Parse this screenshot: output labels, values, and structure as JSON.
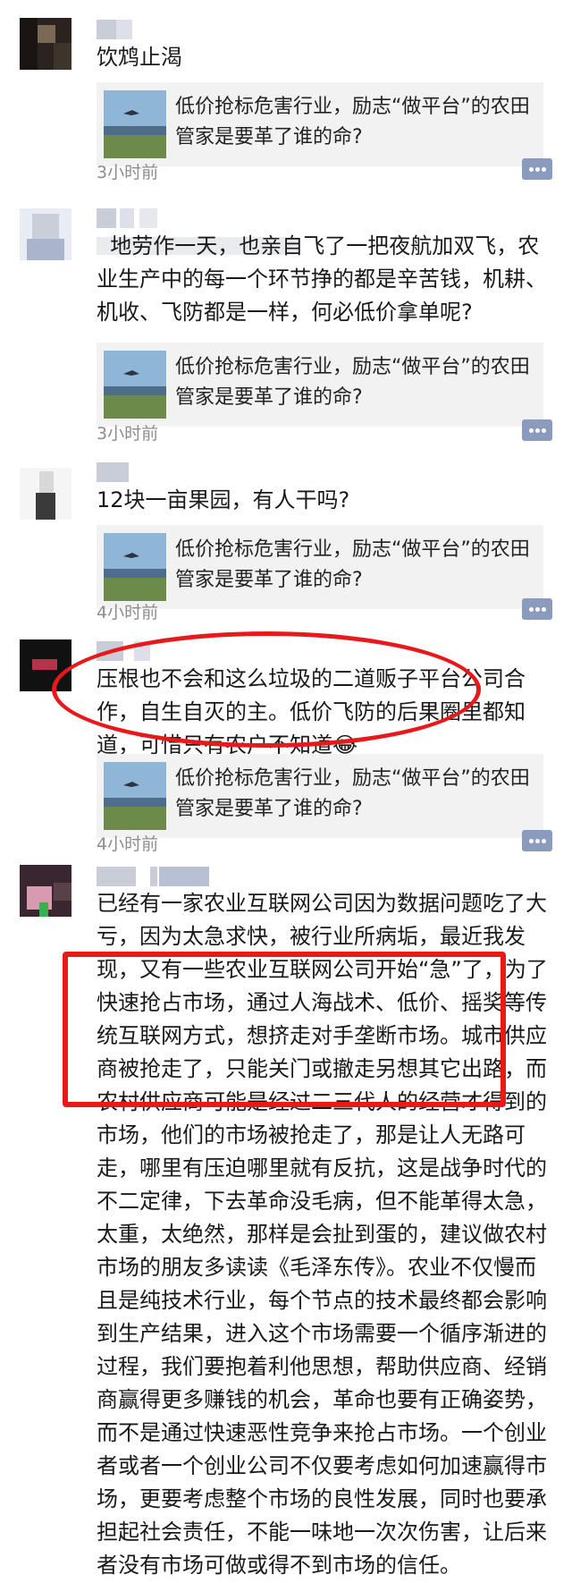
{
  "article_title": "低价抢标危害行业，励志“做平台”的农田管家是要革了谁的命?",
  "posts": [
    {
      "text": "饮鸩止渴",
      "time": "3小时前"
    },
    {
      "text": "  地劳作一天，也亲自飞了一把夜航加双飞，农业生产中的每一个环节挣的都是辛苦钱，机耕、机收、飞防都是一样，何必低价拿单呢?",
      "time": "3小时前"
    },
    {
      "text": "12块一亩果园，有人干吗?",
      "time": "4小时前"
    },
    {
      "text": "压根也不会和这么垃圾的二道贩子平台公司合作，自生自灭的主。低价飞防的后果圈里都知道，可惜只有农户不知道😂",
      "time": "4小时前"
    },
    {
      "text": "已经有一家农业互联网公司因为数据问题吃了大亏，因为太急求快，被行业所病垢，最近我发现，又有一些农业互联网公司开始“急”了，为了快速抢占市场，通过人海战术、低价、摇奖等传统互联网方式，想挤走对手垄断市场。城市供应商被抢走了，只能关门或撤走另想其它出路，而农村供应商可能是经过二三代人的经营才得到的市场，他们的市场被抢走了，那是让人无路可走，哪里有压迫哪里就有反抗，这是战争时代的不二定律，下去革命没毛病，但不能革得太急，太重，太绝然，那样是会扯到蛋的，建议做农村市场的朋友多读读《毛泽东传》。农业不仅慢而且是纯技术行业，每个节点的技术最终都会影响到生产结果，进入这个市场需要一个循序渐进的过程，我们要抱着利他思想，帮助供应商、经销商赢得更多赚钱的机会，革命也要有正确姿势，而不是通过快速恶性竞争来抢占市场。一个创业者或者一个创业公司不仅要考虑如何加速赢得市场，更要考虑整个市场的良性发展，同时也要承担起社会责任，不能一味地一次次伤害，让后来者没有市场可做或得不到市场的信任。"
    }
  ],
  "colors": {
    "highlight": "#e8191a",
    "comment_icon": "#8a9bbd",
    "link_bg": "#f2f2f2"
  },
  "icons": {
    "comment": "comment-bubble-icon",
    "thumb": "landscape-thumbnail-icon"
  }
}
